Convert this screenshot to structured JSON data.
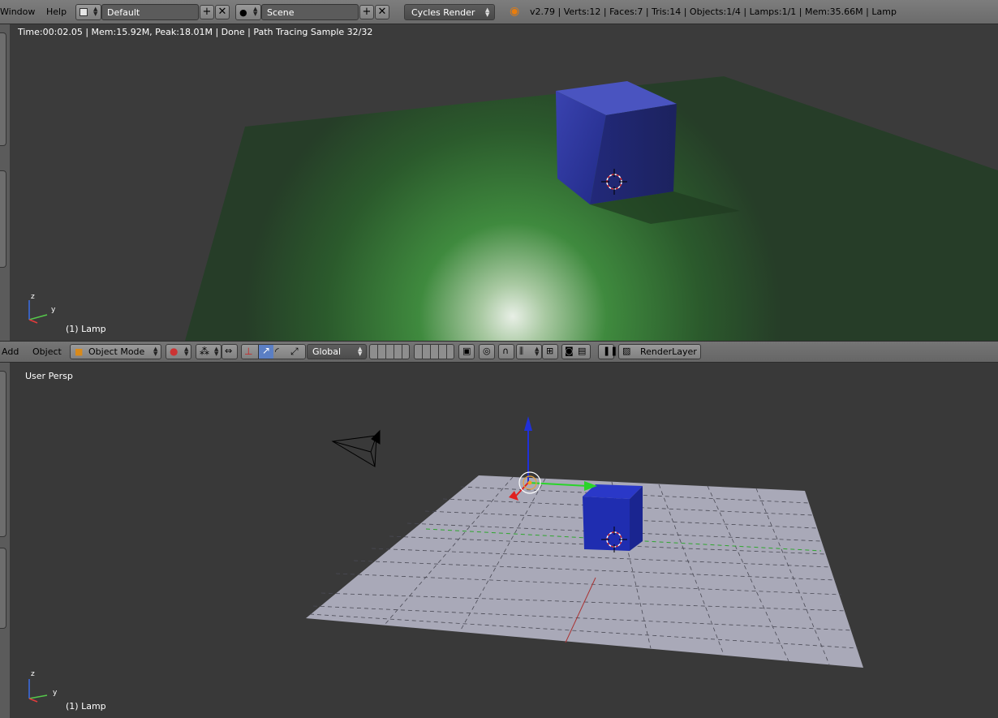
{
  "topbar": {
    "menus": [
      "Window",
      "Help"
    ],
    "screen_layout": "Default",
    "scene": "Scene",
    "render_engine": "Cycles Render",
    "stats": "v2.79 | Verts:12 | Faces:7 | Tris:14 | Objects:1/4 | Lamps:1/1 | Mem:35.66M | Lamp"
  },
  "render_view": {
    "status": "Time:00:02.05 | Mem:15.92M, Peak:18.01M | Done | Path Tracing Sample 32/32",
    "object_label": "(1) Lamp",
    "axes": {
      "z": "z",
      "y": "y"
    }
  },
  "toolbar": {
    "add_menu": "Add",
    "object_menu": "Object",
    "mode": "Object Mode",
    "orientation": "Global",
    "render_layer": "RenderLayer"
  },
  "solid_view": {
    "view_label": "User Persp",
    "object_label": "(1) Lamp",
    "axes": {
      "z": "z",
      "y": "y"
    }
  },
  "colors": {
    "cube_blue": "#2630a8",
    "plane_green": "#2f5a2f",
    "plane_grey": "#a9a9b8",
    "background": "#393939"
  }
}
